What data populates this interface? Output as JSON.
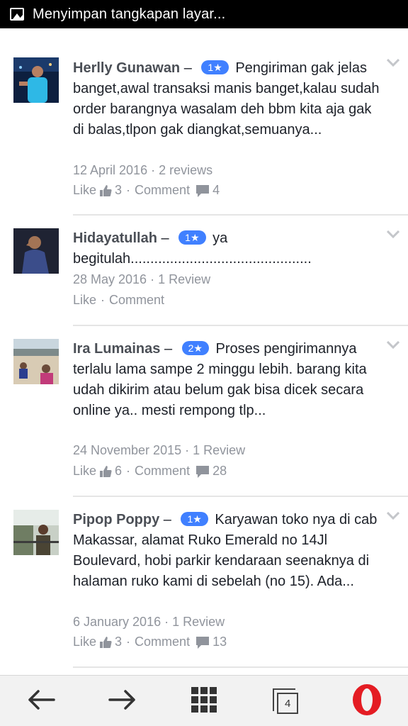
{
  "status_bar": {
    "title": "Menyimpan tangkapan layar..."
  },
  "reviews": [
    {
      "name": "Herlly Gunawan",
      "dash": "–",
      "rating": "1★",
      "text": "Pengiriman gak jelas banget,awal transaksi manis banget,kalau sudah order barangnya wasalam deh bbm kita aja gak di balas,tlpon gak diangkat,semuanya...",
      "meta": "12 April 2016 · 2 reviews",
      "like_label": "Like",
      "like_count": "3",
      "sep": "·",
      "comment_label": "Comment",
      "comment_count": "4"
    },
    {
      "name": "Hidayatullah",
      "dash": "–",
      "rating": "1★",
      "text": "ya begitulah..............................................",
      "meta": "28 May 2016 · 1 Review",
      "like_label": "Like",
      "sep": "·",
      "comment_label": "Comment"
    },
    {
      "name": "Ira Lumainas",
      "dash": "–",
      "rating": "2★",
      "text": "Proses pengirimannya terlalu lama sampe 2 minggu lebih. barang kita udah dikirim atau belum gak bisa dicek secara online ya.. mesti rempong tlp...",
      "meta": "24 November 2015 · 1 Review",
      "like_label": "Like",
      "like_count": "6",
      "sep": "·",
      "comment_label": "Comment",
      "comment_count": "28"
    },
    {
      "name": "Pipop Poppy",
      "dash": "–",
      "rating": "1★",
      "text": "Karyawan toko nya di cab Makassar, alamat Ruko Emerald no 14Jl Boulevard, hobi parkir kendaraan seenaknya di halaman ruko kami di sebelah (no 15). Ada...",
      "meta": "6 January 2016 · 1 Review",
      "like_label": "Like",
      "like_count": "3",
      "sep": "·",
      "comment_label": "Comment",
      "comment_count": "13"
    }
  ],
  "bottom_nav": {
    "back_icon": "arrow-left-icon",
    "forward_icon": "arrow-right-icon",
    "speed_dial_icon": "grid-icon",
    "tabs_count": "4",
    "opera_icon": "opera-logo-icon"
  },
  "colors": {
    "badge": "#4080ff",
    "name": "#4b4f56",
    "meta": "#90949c",
    "opera_red": "#e41c23"
  }
}
